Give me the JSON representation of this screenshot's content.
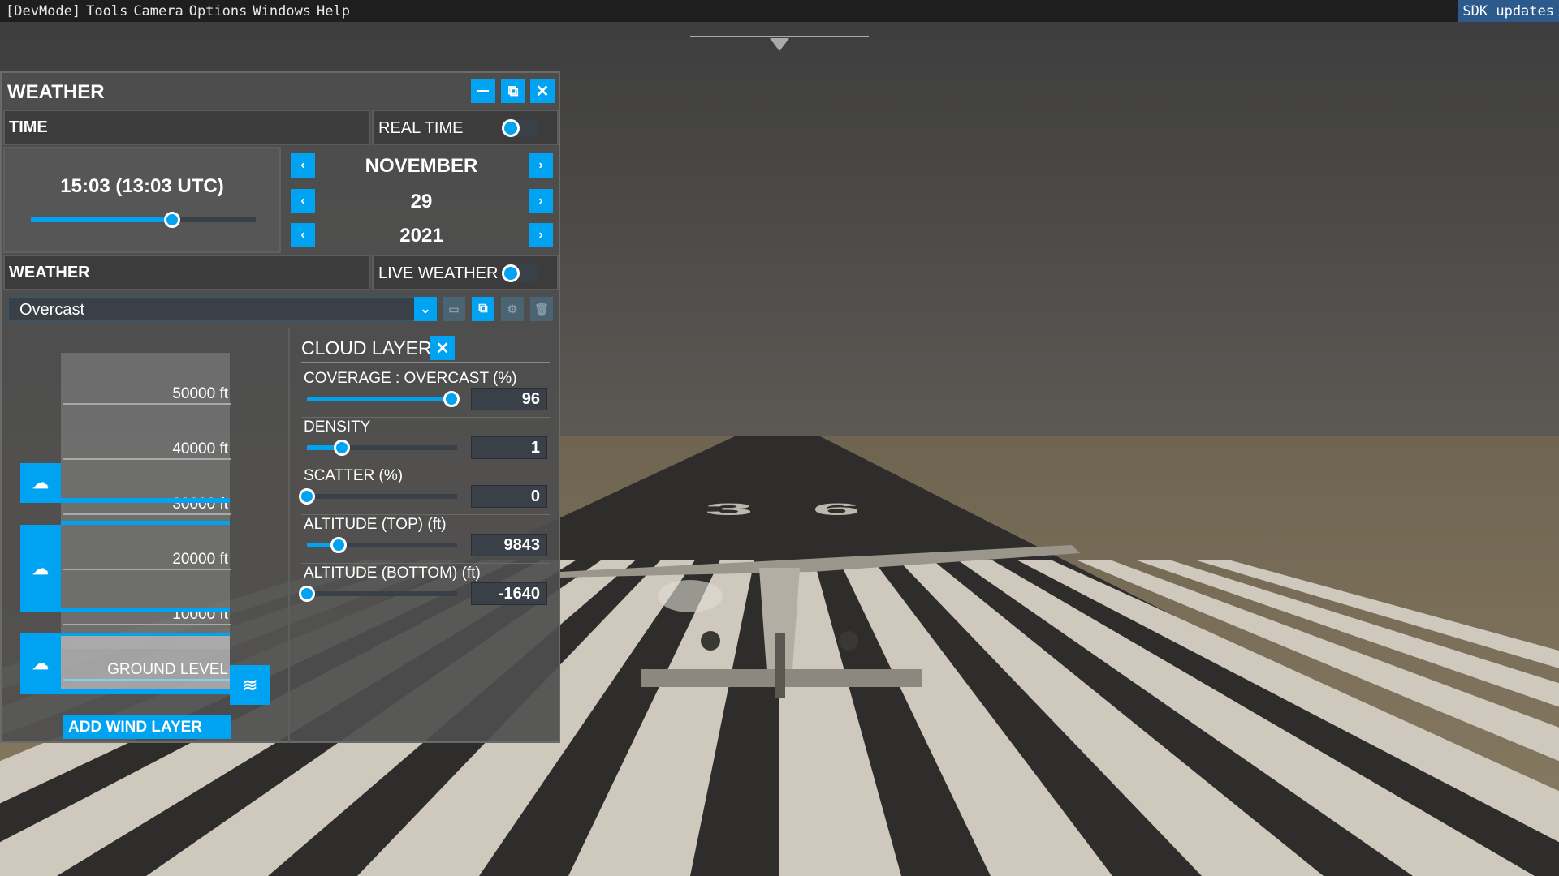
{
  "menubar": {
    "items": [
      "[DevMode]",
      "Tools",
      "Camera",
      "Options",
      "Windows",
      "Help"
    ],
    "sdk_updates": "SDK updates"
  },
  "colors": {
    "accent": "#00a2f2",
    "panel": "#4e4e4e"
  },
  "weather_panel": {
    "title": "WEATHER",
    "buttons": {
      "minimize": "minimize-icon",
      "popout": "external-window-icon",
      "close": "close-icon"
    },
    "time": {
      "header": "TIME",
      "real_time_label": "REAL TIME",
      "real_time_on": false,
      "display": "15:03 (13:03 UTC)",
      "day_fraction": 0.627,
      "month": "NOVEMBER",
      "day": "29",
      "year": "2021"
    },
    "weather": {
      "header": "WEATHER",
      "live_weather_label": "LIVE WEATHER",
      "live_weather_on": false,
      "preset": "Overcast",
      "preset_actions": [
        "save-icon",
        "copy-icon",
        "settings-icon",
        "delete-icon"
      ]
    },
    "altitude_scale": [
      "50000 ft",
      "40000 ft",
      "30000 ft",
      "20000 ft",
      "10000 ft",
      "GROUND LEVEL"
    ],
    "add_wind_layer": "ADD WIND LAYER",
    "cloud_layer": {
      "title": "CLOUD LAYER",
      "params": [
        {
          "label": "COVERAGE : OVERCAST (%)",
          "value": "96",
          "fraction": 0.96
        },
        {
          "label": "DENSITY",
          "value": "1",
          "fraction": 0.23
        },
        {
          "label": "SCATTER (%)",
          "value": "0",
          "fraction": 0
        },
        {
          "label": "ALTITUDE (TOP) (ft)",
          "value": "9843",
          "fraction": 0.21
        },
        {
          "label": "ALTITUDE (BOTTOM) (ft)",
          "value": "-1640",
          "fraction": 0
        }
      ]
    }
  },
  "scene": {
    "runway_number": "36"
  }
}
